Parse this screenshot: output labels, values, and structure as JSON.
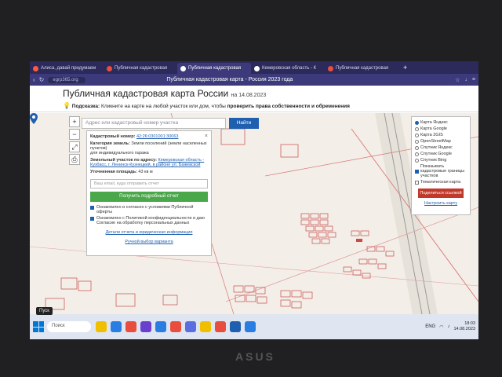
{
  "browser": {
    "tabs": [
      {
        "label": "Алиса, давай придумаем",
        "fav_color": "#ff5a3c",
        "active": false
      },
      {
        "label": "Публичная кадастровая",
        "fav_color": "#e84d3d",
        "active": false
      },
      {
        "label": "Публичная кадастровая",
        "fav_color": "#ffffff",
        "active": true
      },
      {
        "label": "Кемеровская область - К",
        "fav_color": "#ffffff",
        "active": false
      },
      {
        "label": "Публичная кадастровая",
        "fav_color": "#e84d3d",
        "active": false
      }
    ],
    "url": "egrp365.org",
    "page_title": "Публичная кадастровая карта - Россия 2023 года"
  },
  "header": {
    "title": "Публичная кадастровая карта России",
    "date": "на 14.08.2023",
    "hint_label": "Подсказка:",
    "hint_text": "Кликните на карте на любой участок или дом, чтобы",
    "hint_bold": "проверить права собственности и обременения"
  },
  "search": {
    "placeholder": "Адрес или кадастровый номер участка",
    "button": "Найти"
  },
  "popup": {
    "cad_label": "Кадастровый номер:",
    "cad_value": "42:26:0301001:30063",
    "cat_label": "Категория земель:",
    "cat_value": "Земли поселений (земли населенных пунктов)",
    "use_value": "для индивидуального гаража",
    "addr_label": "Земельный участок по адресу:",
    "addr_value": "Кемеровская область - Кузбасс, г. Ленинск-Кузнецкий, в районе ул. Бажевской",
    "area_label": "Уточненная площадь:",
    "area_value": "43 кв м",
    "email_placeholder": "Ваш email, куда отправить отчет",
    "report_button": "Получить подробный отчет",
    "check1": "Ознакомлен и согласен с условиями Публичной оферты",
    "check2": "Ознакомлен с Политикой конфиденциальности и даю Согласие на обработку персональных данных",
    "details_link": "Детали отчета и юридическая информация",
    "other_link": "Ручной выбор варианта"
  },
  "layers": {
    "options": [
      {
        "label": "Карта Яндекс",
        "on": true
      },
      {
        "label": "Карта Google",
        "on": false
      },
      {
        "label": "Карта 2GIS",
        "on": false
      },
      {
        "label": "OpenStreetMap",
        "on": false
      },
      {
        "label": "Спутник Яндекс",
        "on": false
      },
      {
        "label": "Спутник Google",
        "on": false
      },
      {
        "label": "Спутник Bing",
        "on": false
      }
    ],
    "cad_borders": "Показывать кадастровые границы участков",
    "thematic": "Тематическая карта",
    "share_button": "Поделиться ссылкой",
    "setup_link": "Настроить карту"
  },
  "taskbar": {
    "start_tooltip": "Пуск",
    "search_label": "Поиск",
    "tray_lang": "ENG",
    "tray_time": "18:03",
    "tray_date": "14.08.2023",
    "icon_colors": [
      "#f0c000",
      "#2a7de1",
      "#e84d3d",
      "#6a3fd0",
      "#2a7de1",
      "#e84d3d",
      "#5b6ee1",
      "#f0c000",
      "#e84d3d",
      "#1f5fb0",
      "#2a7de1"
    ]
  },
  "laptop_brand": "ASUS"
}
